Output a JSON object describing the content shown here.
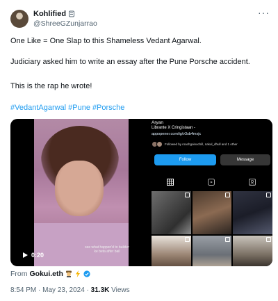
{
  "author": {
    "display_name": "Kohlified",
    "handle": "@ShreeGZunjarrao"
  },
  "body": {
    "line1": "One Like = One Slap to this Shameless Vedant Agarwal.",
    "line2": "Judiciary asked him to write an essay after the Pune Porsche accident.",
    "line3": "This is the rap he wrote!",
    "hashtags": [
      "#VedantAgarwal",
      "#Pune",
      "#Porsche"
    ]
  },
  "media": {
    "video_time": "0:20",
    "video_caption": "see what happen'd to builder ke beta after bail",
    "instagram": {
      "name": "Aryan",
      "bio": "Librante X Cringistaan -",
      "link": "appopener.com/ig/v3sb4mxjc",
      "followed_by": "Followed by roachgoinochill, nakul_dhull and 1 other",
      "follow_label": "Follow",
      "message_label": "Message"
    }
  },
  "attribution": {
    "prefix": "From",
    "user": "Gokui.eth"
  },
  "meta": {
    "time": "8:54 PM",
    "separator": "·",
    "date": "May 23, 2024",
    "views": "31.3K",
    "views_label": "Views"
  },
  "icons": {
    "more": "more-options-icon",
    "badge": "badge-icon",
    "play": "play-icon"
  },
  "colors": {
    "accent": "#1d9bf0",
    "muted": "#536471",
    "text": "#0f1419"
  }
}
